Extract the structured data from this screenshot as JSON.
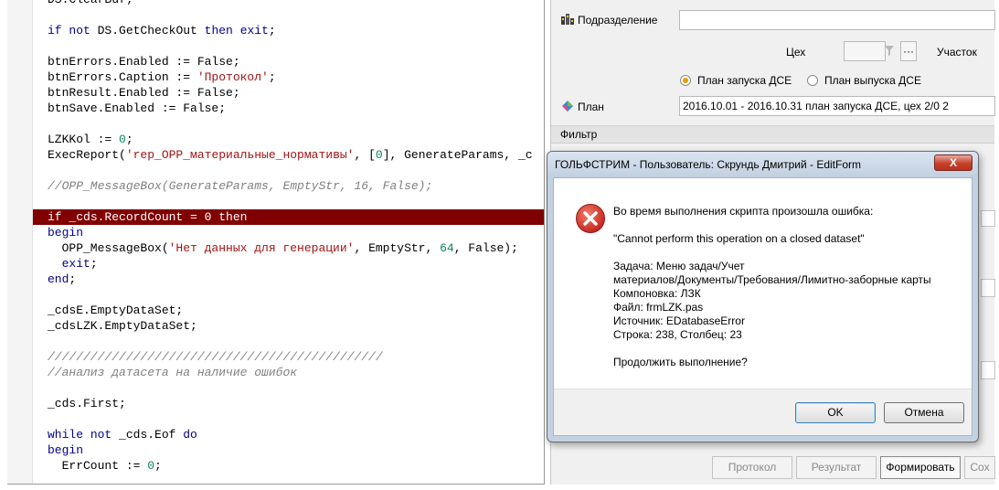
{
  "editor": {
    "lines": [
      {
        "segments": [
          {
            "t": "DS.Cle"
          },
          {
            "t": "arBuf;"
          }
        ]
      },
      {
        "segments": []
      },
      {
        "segments": [
          {
            "t": "if",
            "c": "kw"
          },
          {
            "t": " "
          },
          {
            "t": "not",
            "c": "kw"
          },
          {
            "t": " DS.GetCheckOut "
          },
          {
            "t": "then",
            "c": "kw"
          },
          {
            "t": " "
          },
          {
            "t": "exit",
            "c": "kw"
          },
          {
            "t": ";"
          }
        ]
      },
      {
        "segments": []
      },
      {
        "segments": [
          {
            "t": "btnErrors.Enabled := False;"
          }
        ]
      },
      {
        "segments": [
          {
            "t": "btnErrors.Caption := "
          },
          {
            "t": "'Протокол'",
            "c": "str"
          },
          {
            "t": ";"
          }
        ]
      },
      {
        "segments": [
          {
            "t": "btnResult.Enabled := False;"
          }
        ]
      },
      {
        "segments": [
          {
            "t": "btnSave.Enabled := False;"
          }
        ]
      },
      {
        "segments": []
      },
      {
        "segments": [
          {
            "t": "LZKKol := "
          },
          {
            "t": "0",
            "c": "num"
          },
          {
            "t": ";"
          }
        ]
      },
      {
        "segments": [
          {
            "t": "ExecReport("
          },
          {
            "t": "'rep_OPP_материальные_нормативы'",
            "c": "str"
          },
          {
            "t": ", ["
          },
          {
            "t": "0",
            "c": "num"
          },
          {
            "t": "], GenerateParams, _c"
          }
        ]
      },
      {
        "segments": []
      },
      {
        "segments": [
          {
            "t": "//OPP_MessageBox(GenerateParams, EmptyStr, 16, False);",
            "c": "cm"
          }
        ]
      },
      {
        "segments": []
      },
      {
        "segments": [
          {
            "t": "if",
            "c": "kw"
          },
          {
            "t": " _cds.RecordCount = 0 "
          },
          {
            "t": "then",
            "c": "kw"
          }
        ],
        "highlight": true
      },
      {
        "segments": [
          {
            "t": "begin",
            "c": "kw"
          }
        ]
      },
      {
        "segments": [
          {
            "t": "  OPP_MessageBox("
          },
          {
            "t": "'Нет данных для генерации'",
            "c": "str"
          },
          {
            "t": ", EmptyStr, "
          },
          {
            "t": "64",
            "c": "num"
          },
          {
            "t": ", False);"
          }
        ]
      },
      {
        "segments": [
          {
            "t": "  "
          },
          {
            "t": "exit",
            "c": "kw"
          },
          {
            "t": ";"
          }
        ]
      },
      {
        "segments": [
          {
            "t": "end",
            "c": "kw"
          },
          {
            "t": ";"
          }
        ]
      },
      {
        "segments": []
      },
      {
        "segments": [
          {
            "t": "_cdsE.EmptyDataSet;"
          }
        ]
      },
      {
        "segments": [
          {
            "t": "_cdsLZK.EmptyDataSet;"
          }
        ]
      },
      {
        "segments": []
      },
      {
        "segments": [
          {
            "t": "///////////////////////////////////////////////",
            "c": "cm"
          }
        ]
      },
      {
        "segments": [
          {
            "t": "//анализ датасета на наличие ошибок",
            "c": "cm"
          }
        ]
      },
      {
        "segments": []
      },
      {
        "segments": [
          {
            "t": "_cds.First;"
          }
        ]
      },
      {
        "segments": []
      },
      {
        "segments": [
          {
            "t": "while",
            "c": "kw"
          },
          {
            "t": " "
          },
          {
            "t": "not",
            "c": "kw"
          },
          {
            "t": " _cds.Eof "
          },
          {
            "t": "do",
            "c": "kw"
          }
        ]
      },
      {
        "segments": [
          {
            "t": "begin",
            "c": "kw"
          }
        ]
      },
      {
        "segments": [
          {
            "t": "  ErrCount := "
          },
          {
            "t": "0",
            "c": "num"
          },
          {
            "t": ";"
          }
        ]
      },
      {
        "segments": []
      }
    ]
  },
  "form": {
    "subdivision_label": "Подразделение",
    "workshop_label": "Цех",
    "section_label": "Участок",
    "radio_launch_plan": "План запуска ДСЕ",
    "radio_release_plan": "План выпуска ДСЕ",
    "plan_label": "План",
    "plan_value": "2016.10.01 - 2016.10.31 план запуска ДСЕ, цех 2/0 2",
    "filter_header": "Фильтр",
    "buttons": {
      "protocol": "Протокол",
      "result": "Результат",
      "generate": "Формировать",
      "save": "Сох"
    }
  },
  "dialog": {
    "title": "ГОЛЬФСТРИМ - Пользователь: Скрундь Дмитрий - EditForm",
    "close_glyph": "X",
    "message_header": "Во время выполнения скрипта произошла ошибка:",
    "error_text": "\"Cannot perform this operation on a closed dataset\"",
    "details": [
      "Задача: Меню задач/Учет",
      "материалов/Документы/Требования/Лимитно-заборные карты",
      "Компоновка: ЛЗК",
      "Файл: frmLZK.pas",
      "Источник: EDatabaseError",
      "Строка: 238, Столбец: 23"
    ],
    "question": "Продолжить выполнение?",
    "ok_label": "OK",
    "cancel_label": "Отмена",
    "colors": {
      "error_red": "#d62a2a",
      "titlebar": "#c4d1e1"
    }
  }
}
